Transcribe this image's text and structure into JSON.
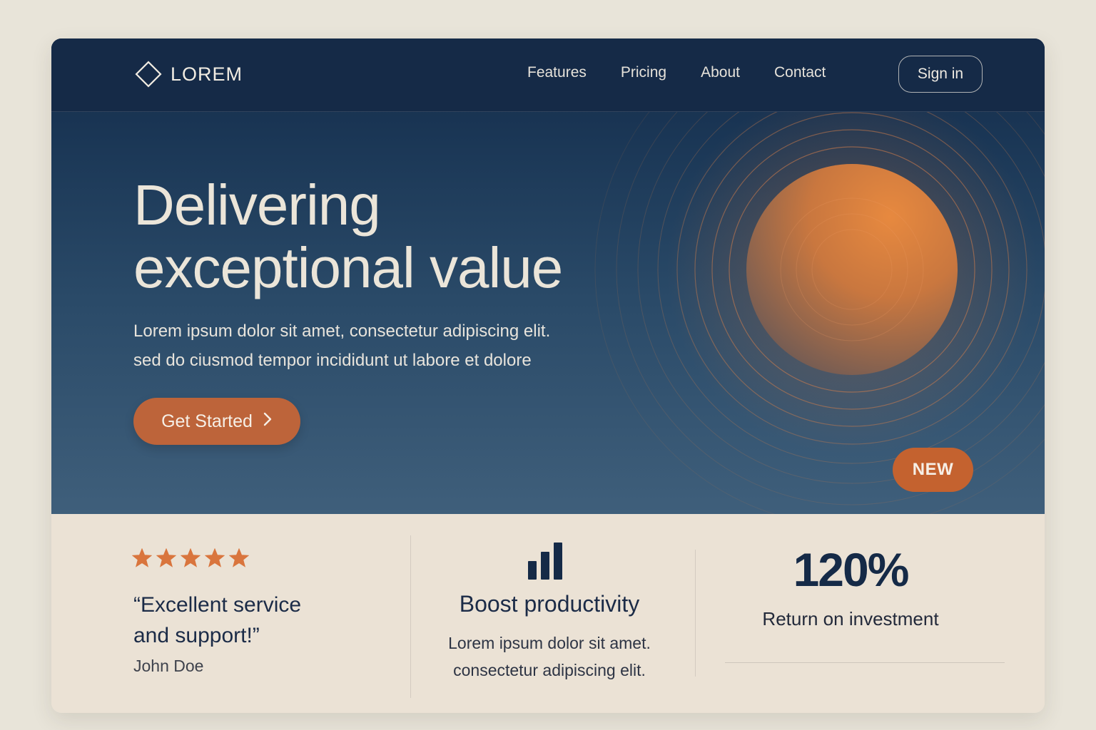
{
  "nav": {
    "logo_text": "LOREM",
    "logo_icon": "diamond-outline-icon",
    "links": [
      {
        "label": "Features"
      },
      {
        "label": "Pricing"
      },
      {
        "label": "About"
      },
      {
        "label": "Contact"
      }
    ],
    "signin_label": "Sign in"
  },
  "hero": {
    "headline_line1": "Delivering",
    "headline_line2": "exceptional value",
    "sub_line1": "Lorem ipsum dolor sit amet, consectetur adipiscing elit.",
    "sub_line2": "sed do ciusmod tempor incididunt ut labore et dolore",
    "cta_label": "Get Started",
    "cta_icon": "chevron-right-icon",
    "badge": "NEW",
    "orb_icon": "orange-orb-with-rings"
  },
  "features": {
    "testimonial": {
      "rating": 5,
      "rating_max": 5,
      "quote_line1": "“Excellent service",
      "quote_line2": "and support!”",
      "author": "John Doe"
    },
    "productivity": {
      "icon": "bar-chart-icon",
      "title": "Boost productivity",
      "desc_line1": "Lorem ipsum dolor sit amet.",
      "desc_line2": "consectetur adipiscing elit."
    },
    "roi": {
      "value": "120%",
      "label": "Return on investment"
    }
  },
  "colors": {
    "navy": "#152a47",
    "accent_orange": "#bd643a",
    "cream": "#ebe2d5",
    "star": "#d9753d"
  }
}
